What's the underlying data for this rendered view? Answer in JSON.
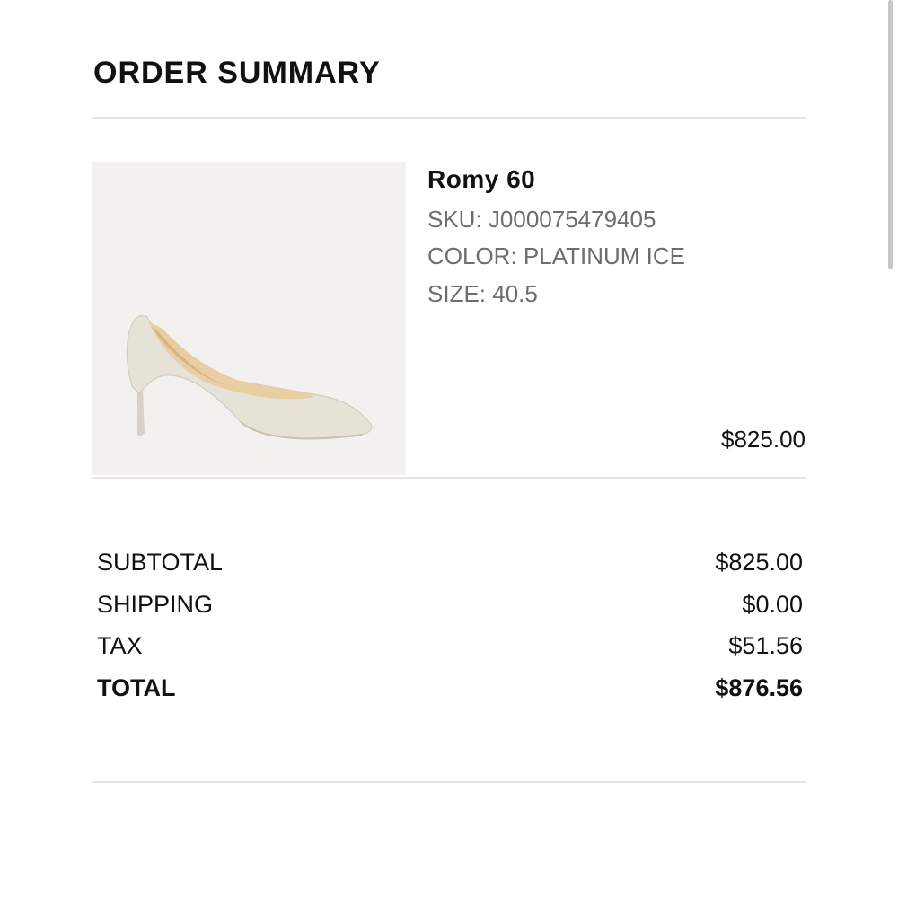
{
  "header": {
    "title": "ORDER SUMMARY"
  },
  "product": {
    "image_icon": "shoe-product-image",
    "name": "Romy 60",
    "sku": "SKU: J000075479405",
    "color": "COLOR: PLATINUM ICE",
    "size": "SIZE: 40.5",
    "price": "$825.00"
  },
  "summary": {
    "subtotal_label": "SUBTOTAL",
    "subtotal_value": "$825.00",
    "shipping_label": "SHIPPING",
    "shipping_value": "$0.00",
    "tax_label": "TAX",
    "tax_value": "$51.56",
    "total_label": "TOTAL",
    "total_value": "$876.56"
  },
  "colors": {
    "text": "#111111",
    "muted_text": "#6d6d6d",
    "divider": "#e4e4e4",
    "image_background": "#f2f1ef"
  }
}
